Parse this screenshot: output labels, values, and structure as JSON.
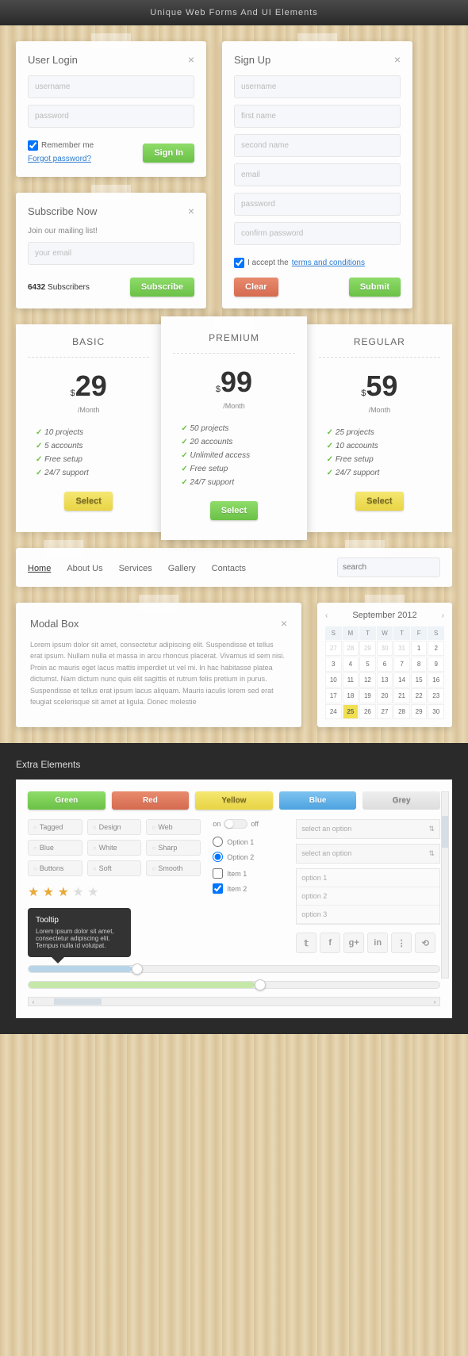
{
  "header": "Unique Web Forms And UI Elements",
  "login": {
    "title": "User Login",
    "username_ph": "username",
    "password_ph": "password",
    "remember": "Remember me",
    "forgot": "Forgot password?",
    "submit": "Sign In"
  },
  "subscribe": {
    "title": "Subscribe Now",
    "help": "Join our mailing list!",
    "email_ph": "your email",
    "count": "6432",
    "count_label": "Subscribers",
    "submit": "Subscribe"
  },
  "signup": {
    "title": "Sign Up",
    "fields": {
      "username": "username",
      "first": "first name",
      "second": "second name",
      "email": "email",
      "password": "password",
      "confirm": "confirm password"
    },
    "accept_pre": "I accept the",
    "accept_link": "terms and conditions",
    "clear": "Clear",
    "submit": "Submit"
  },
  "pricing": [
    {
      "name": "BASIC",
      "price": "29",
      "period": "/Month",
      "features": [
        "10 projects",
        "5 accounts",
        "Free setup",
        "24/7 support"
      ],
      "btn": "Select",
      "btn_class": "btn-yellow"
    },
    {
      "name": "PREMIUM",
      "price": "99",
      "period": "/Month",
      "features": [
        "50 projects",
        "20 accounts",
        "Unlimited access",
        "Free setup",
        "24/7 support"
      ],
      "btn": "Select",
      "btn_class": "btn-green",
      "featured": true
    },
    {
      "name": "REGULAR",
      "price": "59",
      "period": "/Month",
      "features": [
        "25 projects",
        "10 accounts",
        "Free setup",
        "24/7 support"
      ],
      "btn": "Select",
      "btn_class": "btn-yellow"
    }
  ],
  "nav": {
    "items": [
      "Home",
      "About Us",
      "Services",
      "Gallery",
      "Contacts"
    ],
    "search_ph": "search"
  },
  "modal": {
    "title": "Modal Box",
    "text": "Lorem ipsum dolor sit amet, consectetur adipiscing elit. Suspendisse et tellus erat ipsum. Nullam nulla et massa in arcu rhoncus placerat. Vivamus id sem nisi. Proin ac mauris eget lacus mattis imperdiet ut vel mi. In hac habitasse platea dictumst. Nam dictum nunc quis elit sagittis et rutrum felis pretium in purus. Suspendisse et tellus erat ipsum lacus aliquam. Mauris iaculis lorem sed erat feugiat scelerisque sit amet at ligula. Donec molestie"
  },
  "calendar": {
    "month": "September 2012",
    "dow": [
      "S",
      "M",
      "T",
      "W",
      "T",
      "F",
      "S"
    ],
    "days": [
      {
        "d": "27",
        "m": true
      },
      {
        "d": "28",
        "m": true
      },
      {
        "d": "29",
        "m": true
      },
      {
        "d": "30",
        "m": true
      },
      {
        "d": "31",
        "m": true
      },
      {
        "d": "1"
      },
      {
        "d": "2"
      },
      {
        "d": "3"
      },
      {
        "d": "4"
      },
      {
        "d": "5"
      },
      {
        "d": "6"
      },
      {
        "d": "7"
      },
      {
        "d": "8"
      },
      {
        "d": "9"
      },
      {
        "d": "10"
      },
      {
        "d": "11"
      },
      {
        "d": "12"
      },
      {
        "d": "13"
      },
      {
        "d": "14"
      },
      {
        "d": "15"
      },
      {
        "d": "16"
      },
      {
        "d": "17"
      },
      {
        "d": "18"
      },
      {
        "d": "19"
      },
      {
        "d": "20"
      },
      {
        "d": "21"
      },
      {
        "d": "22"
      },
      {
        "d": "23"
      },
      {
        "d": "24"
      },
      {
        "d": "25",
        "sel": true
      },
      {
        "d": "26"
      },
      {
        "d": "27"
      },
      {
        "d": "28"
      },
      {
        "d": "29"
      },
      {
        "d": "30"
      }
    ]
  },
  "extra": {
    "title": "Extra Elements",
    "colors": [
      {
        "l": "Green",
        "c": "btn-green"
      },
      {
        "l": "Red",
        "c": "btn-red"
      },
      {
        "l": "Yellow",
        "c": "btn-yellow"
      },
      {
        "l": "Blue",
        "c": "btn-blue-flat"
      },
      {
        "l": "Grey",
        "c": "btn-grey"
      }
    ],
    "tags": [
      [
        "Tagged",
        "Design",
        "Web"
      ],
      [
        "Blue",
        "White",
        "Sharp"
      ],
      [
        "Buttons",
        "Soft",
        "Smooth"
      ]
    ],
    "tooltip": {
      "title": "Tooltip",
      "text": "Lorem ipsum dolor sit amet, consectetur adipiscing elit. Ternpus nulla id volutpat."
    },
    "toggle": {
      "on": "on",
      "off": "off"
    },
    "radios": [
      "Option 1",
      "Option 2"
    ],
    "checks": [
      "Item 1",
      "Item 2"
    ],
    "select_ph": "select an option",
    "list_opts": [
      "option 1",
      "option 2",
      "option 3"
    ],
    "social": [
      "twitter",
      "facebook",
      "google-plus",
      "linkedin",
      "rss",
      "share"
    ]
  }
}
